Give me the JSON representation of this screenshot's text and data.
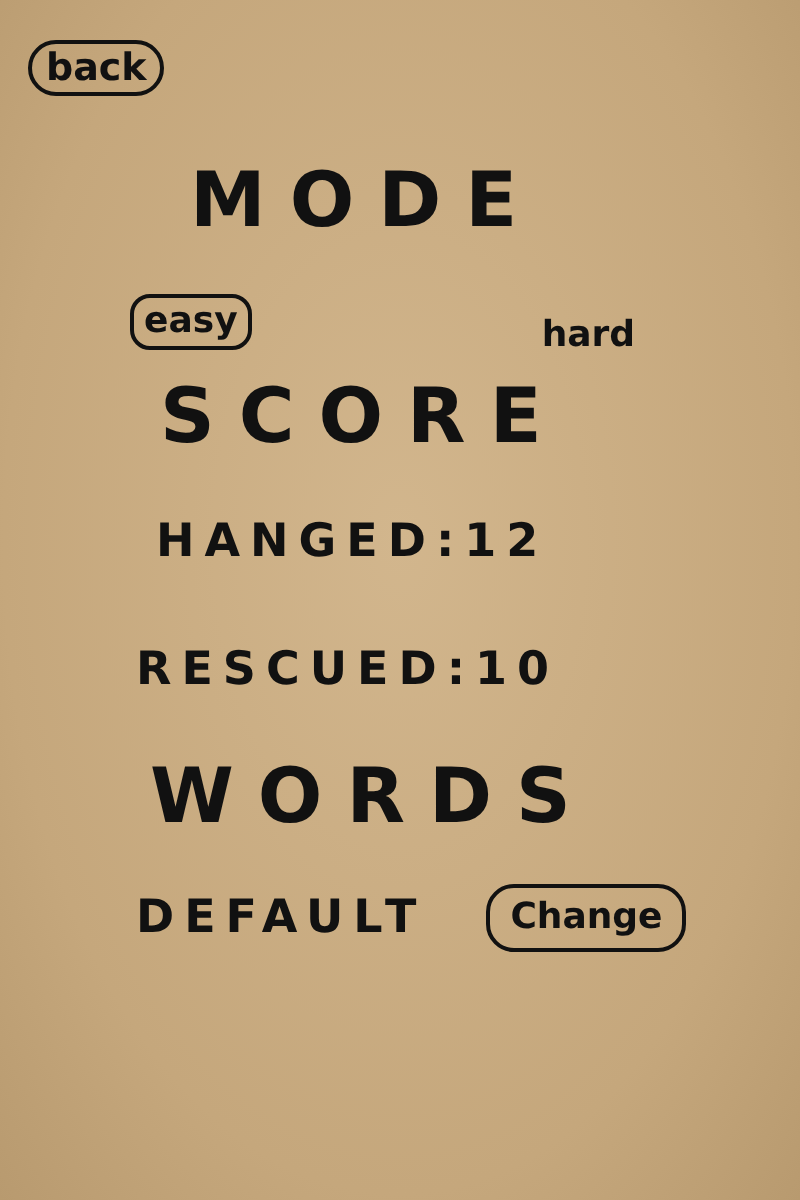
{
  "back_button": "back",
  "mode": {
    "title": "MODE",
    "options": [
      {
        "label": "easy",
        "selected": true
      },
      {
        "label": "hard",
        "selected": false
      }
    ]
  },
  "score": {
    "title": "SCORE",
    "stats": [
      "HANGED:12",
      "RESCUED:10"
    ]
  },
  "words": {
    "title": "WORDS",
    "current": "DEFAULT",
    "change_button": "Change"
  }
}
